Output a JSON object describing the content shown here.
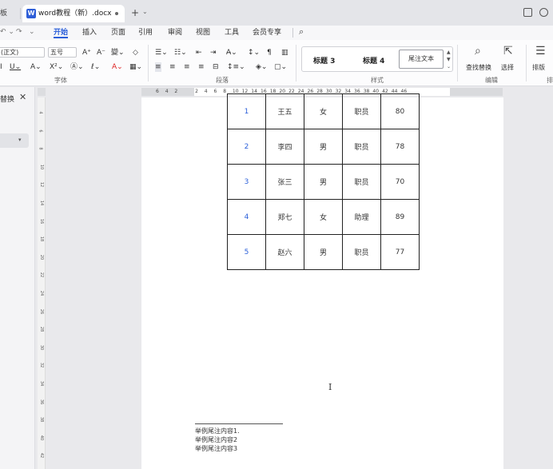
{
  "tabs": {
    "prev_label": "板",
    "active_title": "word教程（新）.docx",
    "new_tab": "+"
  },
  "menu": {
    "items": [
      "开始",
      "插入",
      "页面",
      "引用",
      "审阅",
      "视图",
      "工具",
      "会员专享"
    ],
    "active": "开始"
  },
  "ribbon": {
    "font_name": "(正文)",
    "font_size": "五号",
    "styles": [
      "标题 3",
      "标题 4",
      "尾注文本"
    ],
    "group_labels": {
      "font": "字体",
      "paragraph": "段落",
      "styles": "样式",
      "edit": "编辑",
      "layout": "排"
    },
    "find_replace": "查找替换",
    "select": "选择",
    "arrange": "排版"
  },
  "nav_pane": {
    "title": "替换",
    "close": "✕"
  },
  "ruler": {
    "h_ticks": [
      "6",
      "4",
      "2",
      "2",
      "4",
      "6",
      "8",
      "10",
      "12",
      "14",
      "16",
      "18",
      "20",
      "22",
      "24",
      "26",
      "28",
      "30",
      "32",
      "34",
      "36",
      "38",
      "40",
      "42",
      "44",
      "46"
    ],
    "v_ticks": [
      "4",
      "6",
      "8",
      "10",
      "12",
      "14",
      "16",
      "18",
      "20",
      "22",
      "24",
      "26",
      "28",
      "30",
      "32",
      "34",
      "36",
      "38",
      "40",
      "42"
    ]
  },
  "table": {
    "rows": [
      [
        "1",
        "王五",
        "女",
        "职员",
        "80"
      ],
      [
        "2",
        "李四",
        "男",
        "职员",
        "78"
      ],
      [
        "3",
        "张三",
        "男",
        "职员",
        "70"
      ],
      [
        "4",
        "郑七",
        "女",
        "助理",
        "89"
      ],
      [
        "5",
        "赵六",
        "男",
        "职员",
        "77"
      ]
    ]
  },
  "endnotes": [
    "举例尾注内容1.",
    "举例尾注内容2",
    "举例尾注内容3"
  ],
  "colors": {
    "accent": "#2b5fd9",
    "page": "#ffffff",
    "background": "#e9e9ec"
  }
}
